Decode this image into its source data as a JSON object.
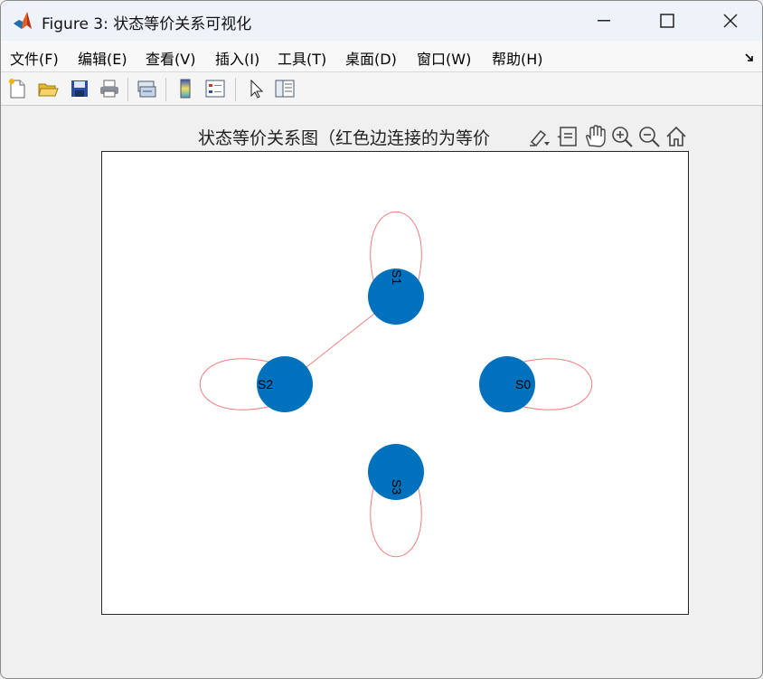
{
  "window": {
    "title": "Figure 3: 状态等价关系可视化",
    "controls": [
      "minimize",
      "maximize",
      "close"
    ]
  },
  "menubar": {
    "items": [
      "文件(F)",
      "编辑(E)",
      "查看(V)",
      "插入(I)",
      "工具(T)",
      "桌面(D)",
      "窗口(W)",
      "帮助(H)"
    ]
  },
  "toolbar": {
    "buttons": [
      "new-figure-icon",
      "open-file-icon",
      "save-icon",
      "print-icon",
      "link-plot-icon",
      "colorbar-icon",
      "legend-icon",
      "edit-plot-arrow-icon",
      "property-inspector-icon"
    ]
  },
  "axes": {
    "title": "状态等价关系图（红色边连接的为等价",
    "toolbar": [
      "brush-icon",
      "data-tips-icon",
      "pan-hand-icon",
      "zoom-in-icon",
      "zoom-out-icon",
      "home-icon"
    ]
  },
  "graph": {
    "edge_color": "#f08080",
    "node_color": "#0072bd",
    "nodes": [
      {
        "id": "S0"
      },
      {
        "id": "S1"
      },
      {
        "id": "S2"
      },
      {
        "id": "S3"
      }
    ],
    "edges": [
      {
        "from": "S0",
        "to": "S0"
      },
      {
        "from": "S1",
        "to": "S1"
      },
      {
        "from": "S2",
        "to": "S2"
      },
      {
        "from": "S3",
        "to": "S3"
      },
      {
        "from": "S1",
        "to": "S2"
      }
    ]
  }
}
